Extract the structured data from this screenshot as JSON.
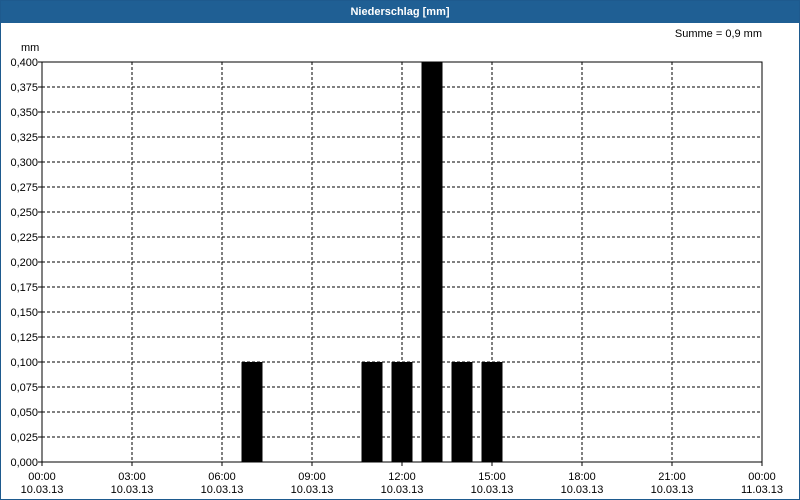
{
  "window": {
    "title": "Niederschlag [mm]"
  },
  "chart_data": {
    "type": "bar",
    "title": "Niederschlag [mm]",
    "ylabel": "mm",
    "annotation": "Summe = 0,9 mm",
    "ylim": [
      0,
      0.4
    ],
    "yticks": [
      "0,000",
      "0,025",
      "0,050",
      "0,075",
      "0,100",
      "0,125",
      "0,150",
      "0,175",
      "0,200",
      "0,225",
      "0,250",
      "0,275",
      "0,300",
      "0,325",
      "0,350",
      "0,375",
      "0,400"
    ],
    "xlim_hours": [
      0,
      24
    ],
    "xticks": [
      {
        "time": "00:00",
        "date": "10.03.13"
      },
      {
        "time": "03:00",
        "date": "10.03.13"
      },
      {
        "time": "06:00",
        "date": "10.03.13"
      },
      {
        "time": "09:00",
        "date": "10.03.13"
      },
      {
        "time": "12:00",
        "date": "10.03.13"
      },
      {
        "time": "15:00",
        "date": "10.03.13"
      },
      {
        "time": "18:00",
        "date": "10.03.13"
      },
      {
        "time": "21:00",
        "date": "10.03.13"
      },
      {
        "time": "00:00",
        "date": "11.03.13"
      }
    ],
    "bar_color": "#000000",
    "grid": true,
    "bars": [
      {
        "x": "10.03.13 07:00",
        "value": 0.1
      },
      {
        "x": "10.03.13 11:00",
        "value": 0.1
      },
      {
        "x": "10.03.13 12:00",
        "value": 0.1
      },
      {
        "x": "10.03.13 13:00",
        "value": 0.4
      },
      {
        "x": "10.03.13 14:00",
        "value": 0.1
      },
      {
        "x": "10.03.13 15:00",
        "value": 0.1
      }
    ]
  }
}
